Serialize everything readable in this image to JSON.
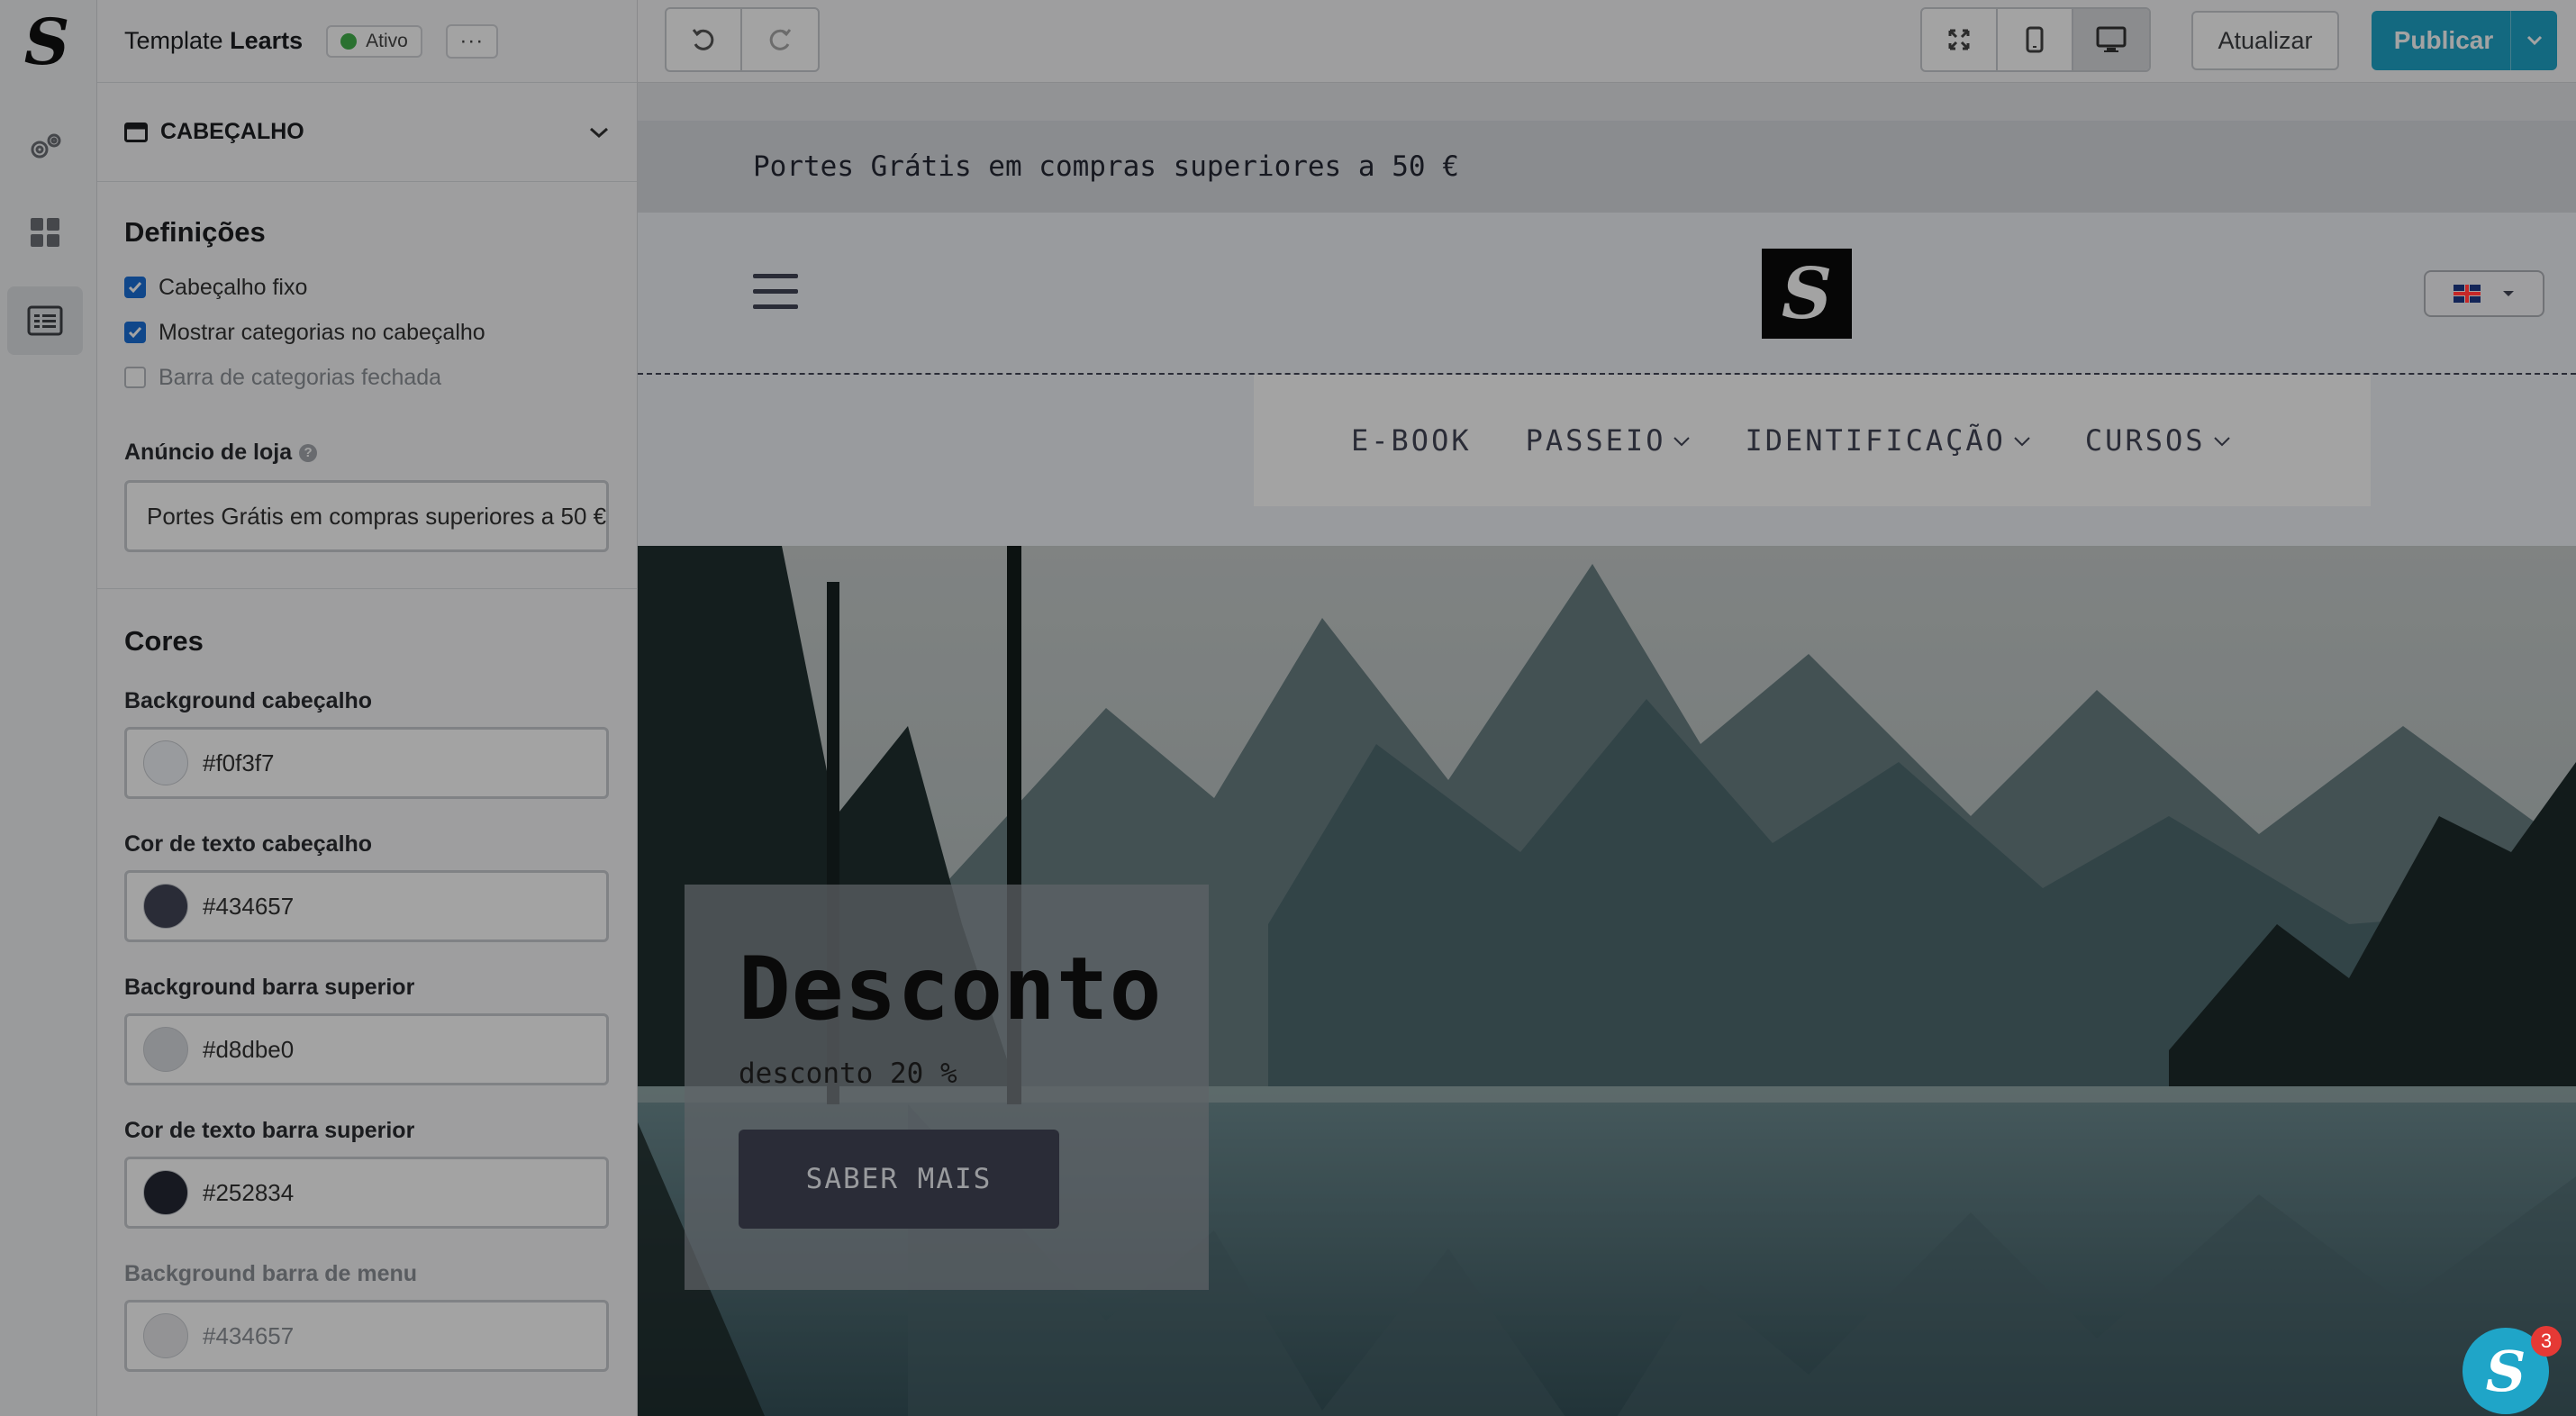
{
  "app": {
    "logo_letter": "S",
    "template_prefix": "Template",
    "template_name": "Learts",
    "status_label": "Ativo",
    "more_label": "···"
  },
  "rail": {
    "items": [
      "settings-gears-icon",
      "grid-blocks-icon",
      "layout-sections-icon"
    ],
    "active_index": 2
  },
  "section": {
    "title": "CABEÇALHO"
  },
  "definicoes": {
    "title": "Definições",
    "options": [
      {
        "label": "Cabeçalho fixo",
        "checked": true
      },
      {
        "label": "Mostrar categorias no cabeçalho",
        "checked": true
      },
      {
        "label": "Barra de categorias fechada",
        "checked": false
      }
    ],
    "announcement_label": "Anúncio de loja",
    "announcement_value": "Portes Grátis em compras superiores a 50 €"
  },
  "cores": {
    "title": "Cores",
    "fields": [
      {
        "label": "Background cabeçalho",
        "value": "#f0f3f7"
      },
      {
        "label": "Cor de texto cabeçalho",
        "value": "#434657"
      },
      {
        "label": "Background barra superior",
        "value": "#d8dbe0"
      },
      {
        "label": "Cor de texto barra superior",
        "value": "#252834"
      },
      {
        "label": "Background barra de menu",
        "value": "#434657"
      }
    ]
  },
  "toolbar": {
    "undo_icon": "undo-icon",
    "redo_icon": "redo-icon",
    "view_modes": [
      "fullscreen-icon",
      "mobile-icon",
      "desktop-icon"
    ],
    "selected_view": "desktop",
    "update_label": "Atualizar",
    "publish_label": "Publicar"
  },
  "preview": {
    "topbar_text": "Portes Grátis em compras superiores a 50 €",
    "logo_letter": "S",
    "language": "en-GB",
    "menu": [
      {
        "label": "E-BOOK",
        "dropdown": false
      },
      {
        "label": "PASSEIO",
        "dropdown": true
      },
      {
        "label": "IDENTIFICAÇÃO",
        "dropdown": true
      },
      {
        "label": "CURSOS",
        "dropdown": true
      }
    ],
    "hero": {
      "title": "Desconto",
      "subtitle": "desconto 20 %",
      "button": "SABER MAIS"
    }
  },
  "chat": {
    "letter": "S",
    "unread": "3"
  },
  "colors": {
    "accent": "#1fa5c8",
    "status_green": "#43b14b",
    "checkbox_blue": "#1a6fd8"
  }
}
